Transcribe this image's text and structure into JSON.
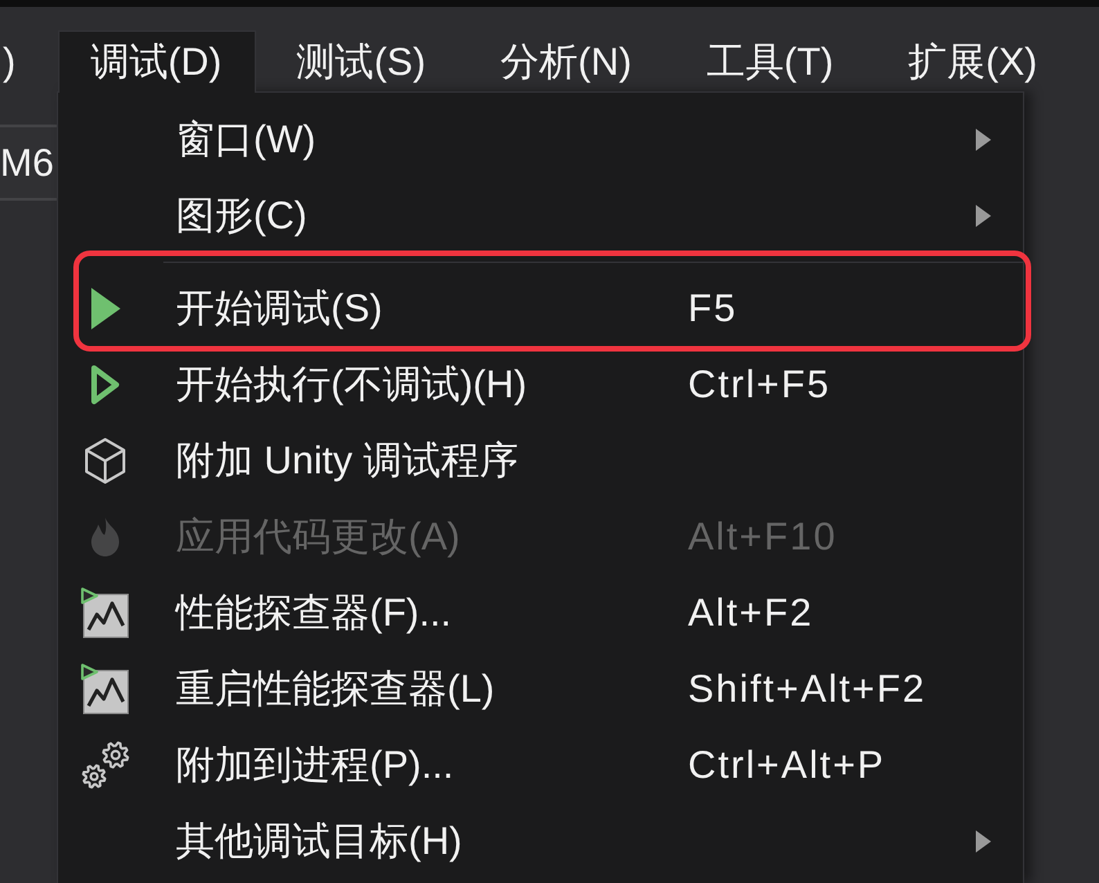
{
  "menu_bar": {
    "items": [
      {
        "label": ")",
        "selected": false
      },
      {
        "label": "调试(D)",
        "selected": true
      },
      {
        "label": "测试(S)",
        "selected": false
      },
      {
        "label": "分析(N)",
        "selected": false
      },
      {
        "label": "工具(T)",
        "selected": false
      },
      {
        "label": "扩展(X)",
        "selected": false
      }
    ]
  },
  "side_panel": {
    "label": "M6"
  },
  "dropdown": {
    "items": [
      {
        "kind": "item",
        "label": "窗口(W)",
        "submenu": true,
        "disabled": false,
        "highlighted": false
      },
      {
        "kind": "item",
        "label": "图形(C)",
        "submenu": true,
        "disabled": false,
        "highlighted": false
      },
      {
        "kind": "separator"
      },
      {
        "kind": "item",
        "label": "开始调试(S)",
        "shortcut": "F5",
        "submenu": false,
        "disabled": false,
        "highlighted": true
      },
      {
        "kind": "item",
        "label": "开始执行(不调试)(H)",
        "shortcut": "Ctrl+F5",
        "submenu": false,
        "disabled": false,
        "highlighted": false
      },
      {
        "kind": "item",
        "label": "附加 Unity 调试程序",
        "submenu": false,
        "disabled": false,
        "highlighted": false
      },
      {
        "kind": "item",
        "label": "应用代码更改(A)",
        "shortcut": "Alt+F10",
        "submenu": false,
        "disabled": true,
        "highlighted": false
      },
      {
        "kind": "item",
        "label": "性能探查器(F)...",
        "shortcut": "Alt+F2",
        "submenu": false,
        "disabled": false,
        "highlighted": false
      },
      {
        "kind": "item",
        "label": "重启性能探查器(L)",
        "shortcut": "Shift+Alt+F2",
        "submenu": false,
        "disabled": false,
        "highlighted": false
      },
      {
        "kind": "item",
        "label": "附加到进程(P)...",
        "shortcut": "Ctrl+Alt+P",
        "submenu": false,
        "disabled": false,
        "highlighted": false
      },
      {
        "kind": "item",
        "label": "其他调试目标(H)",
        "submenu": true,
        "disabled": false,
        "highlighted": false
      }
    ]
  }
}
